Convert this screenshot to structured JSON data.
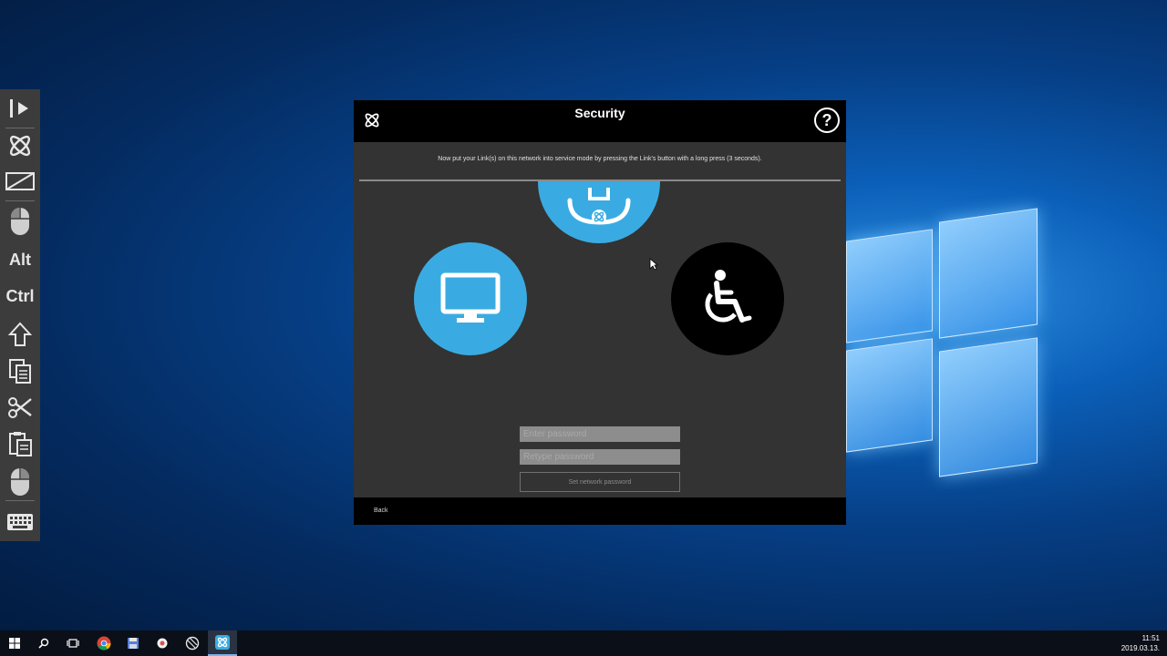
{
  "dialog": {
    "title": "Security",
    "help_label": "?",
    "instruction": "Now put your Link(s) on this network into service mode by pressing the Link's button with a long press (3 seconds).",
    "password_placeholder": "Enter password",
    "repeat_placeholder": "Retype password",
    "set_button_label": "Set network password",
    "back_label": "Back",
    "accent_color": "#3aabe2"
  },
  "toolbar": {
    "items": [
      {
        "icon": "play-icon"
      },
      {
        "icon": "app-logo-icon"
      },
      {
        "icon": "display-off-icon"
      },
      {
        "icon": "mouse-left-icon"
      },
      {
        "label": "Alt"
      },
      {
        "label": "Ctrl"
      },
      {
        "icon": "shift-arrow-icon"
      },
      {
        "icon": "copy-icon"
      },
      {
        "icon": "scissors-icon"
      },
      {
        "icon": "paste-icon"
      },
      {
        "icon": "mouse-right-icon"
      },
      {
        "icon": "keyboard-icon"
      }
    ]
  },
  "taskbar": {
    "time": "11:51",
    "date": "2019.03.13."
  }
}
